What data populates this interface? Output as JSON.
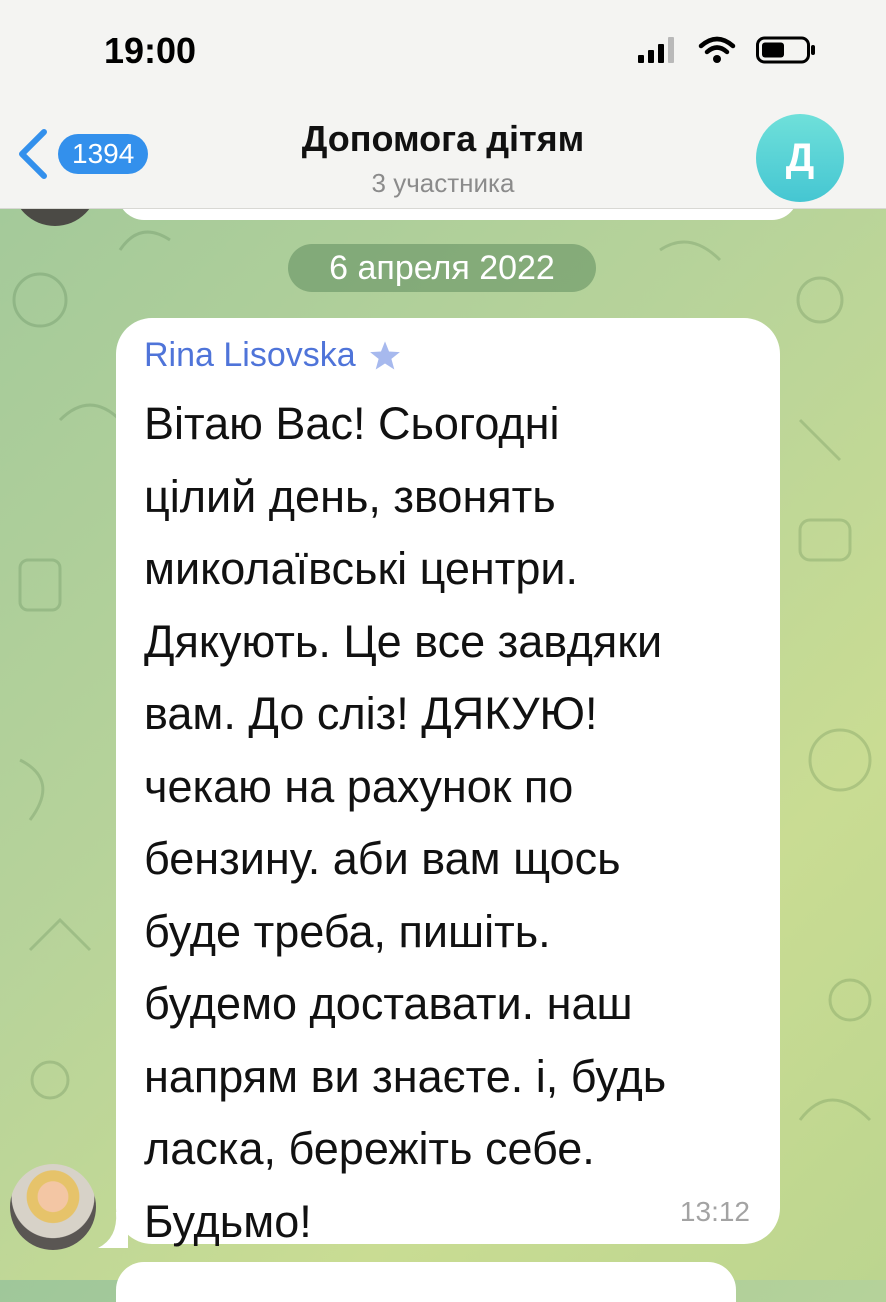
{
  "status_bar": {
    "time": "19:00"
  },
  "header": {
    "back_count": "1394",
    "title": "Допомога дітям",
    "subtitle": "3 участника",
    "avatar_letter": "Д"
  },
  "chat": {
    "date_label": "6 апреля 2022",
    "message": {
      "sender": "Rina Lisovska",
      "text": "Вітаю Вас! Сьогодні\nцілий день, звонять\nмиколаївські центри.\nДякують. Це все завдяки\nвам. До сліз! ДЯКУЮ!\nчекаю на рахунок по\nбензину. аби вам щось\nбуде треба, пишіть.\nбудемо доставати. наш\nнапрям ви знаєте. і, будь\nласка, бережіть себе.\nБудьмо!",
      "time": "13:12"
    }
  },
  "colors": {
    "accent": "#3390ec",
    "sender_name": "#4f74d9",
    "avatar": "#45c6d2",
    "date_pill": "#6a9a66"
  },
  "icons": [
    "signal-icon",
    "wifi-icon",
    "battery-icon",
    "chevron-left-icon",
    "star-icon"
  ]
}
